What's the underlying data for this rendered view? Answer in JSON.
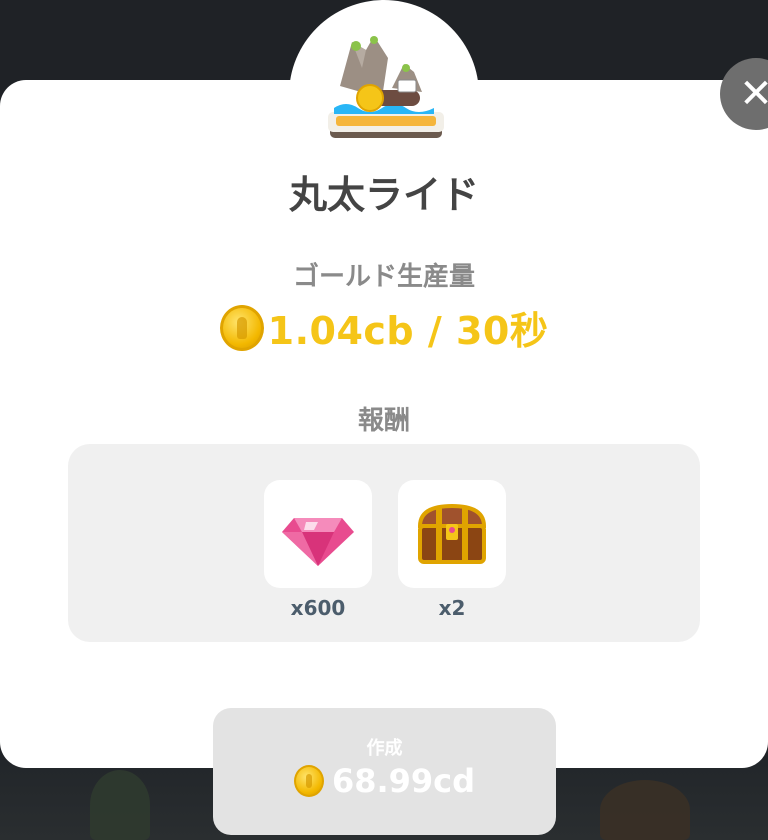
{
  "building": {
    "title": "丸太ライド",
    "icon": "log-ride-icon"
  },
  "production": {
    "label": "ゴールド生産量",
    "value": "1.04cb / 30秒",
    "icon": "gold-coin-icon"
  },
  "rewards": {
    "label": "報酬",
    "items": [
      {
        "icon": "pink-gem-icon",
        "quantity": "x600"
      },
      {
        "icon": "treasure-chest-icon",
        "quantity": "x2"
      }
    ]
  },
  "build_button": {
    "label": "作成",
    "cost": "68.99cd",
    "icon": "gold-coin-icon"
  },
  "close": {
    "icon": "close-icon",
    "glyph": "✕"
  },
  "colors": {
    "gold_text": "#f5c518",
    "title_text": "#444444",
    "muted_label": "#8a8a8a",
    "qty_text": "#4c5d6c",
    "disabled_button": "#e3e3e3"
  }
}
